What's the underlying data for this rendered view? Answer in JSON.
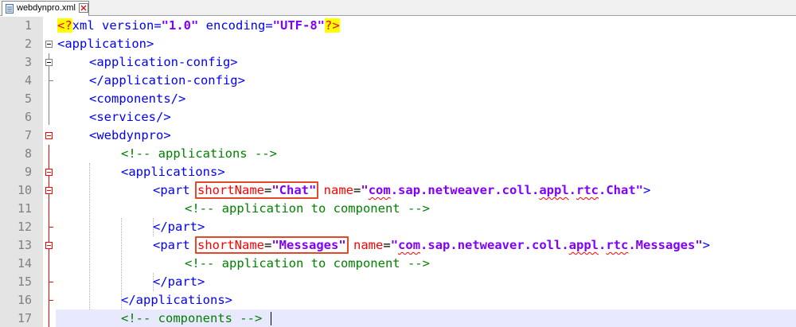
{
  "tab": {
    "filename": "webdynpro.xml"
  },
  "lines": [
    {
      "n": "1",
      "pi_open": "<?",
      "pi_text": "xml version=",
      "v1": "\"1.0\"",
      "pi_mid": " encoding=",
      "v2": "\"UTF-8\"",
      "pi_close": "?>"
    },
    {
      "n": "2",
      "text": "<application>"
    },
    {
      "n": "3",
      "text": "<application-config>"
    },
    {
      "n": "4",
      "text": "</application-config>"
    },
    {
      "n": "5",
      "text": "<components/>"
    },
    {
      "n": "6",
      "text": "<services/>"
    },
    {
      "n": "7",
      "text": "<webdynpro>"
    },
    {
      "n": "8",
      "text": "<!-- applications -->"
    },
    {
      "n": "9",
      "text": "<applications>"
    },
    {
      "n": "10",
      "open": "<part ",
      "attr1": "shortName",
      "eq1": "=",
      "val1": "\"Chat\"",
      "attr2": " name",
      "eq2": "=",
      "val2a": "\"",
      "val2b": "com",
      "val2c": ".sap.netweaver.coll.",
      "val2d": "appl",
      "val2e": ".",
      "val2f": "rtc",
      "val2g": ".Chat\"",
      "close": ">"
    },
    {
      "n": "11",
      "text": "<!-- application to component -->"
    },
    {
      "n": "12",
      "text": "</part>"
    },
    {
      "n": "13",
      "open": "<part ",
      "attr1": "shortName",
      "eq1": "=",
      "val1": "\"Messages\"",
      "attr2": " name",
      "eq2": "=",
      "val2a": "\"",
      "val2b": "com",
      "val2c": ".sap.netweaver.coll.",
      "val2d": "appl",
      "val2e": ".",
      "val2f": "rtc",
      "val2g": ".Messages\"",
      "close": ">"
    },
    {
      "n": "14",
      "text": "<!-- application to component -->"
    },
    {
      "n": "15",
      "text": "</part>"
    },
    {
      "n": "16",
      "text": "</applications>"
    },
    {
      "n": "17",
      "text": "<!-- components -->"
    }
  ]
}
